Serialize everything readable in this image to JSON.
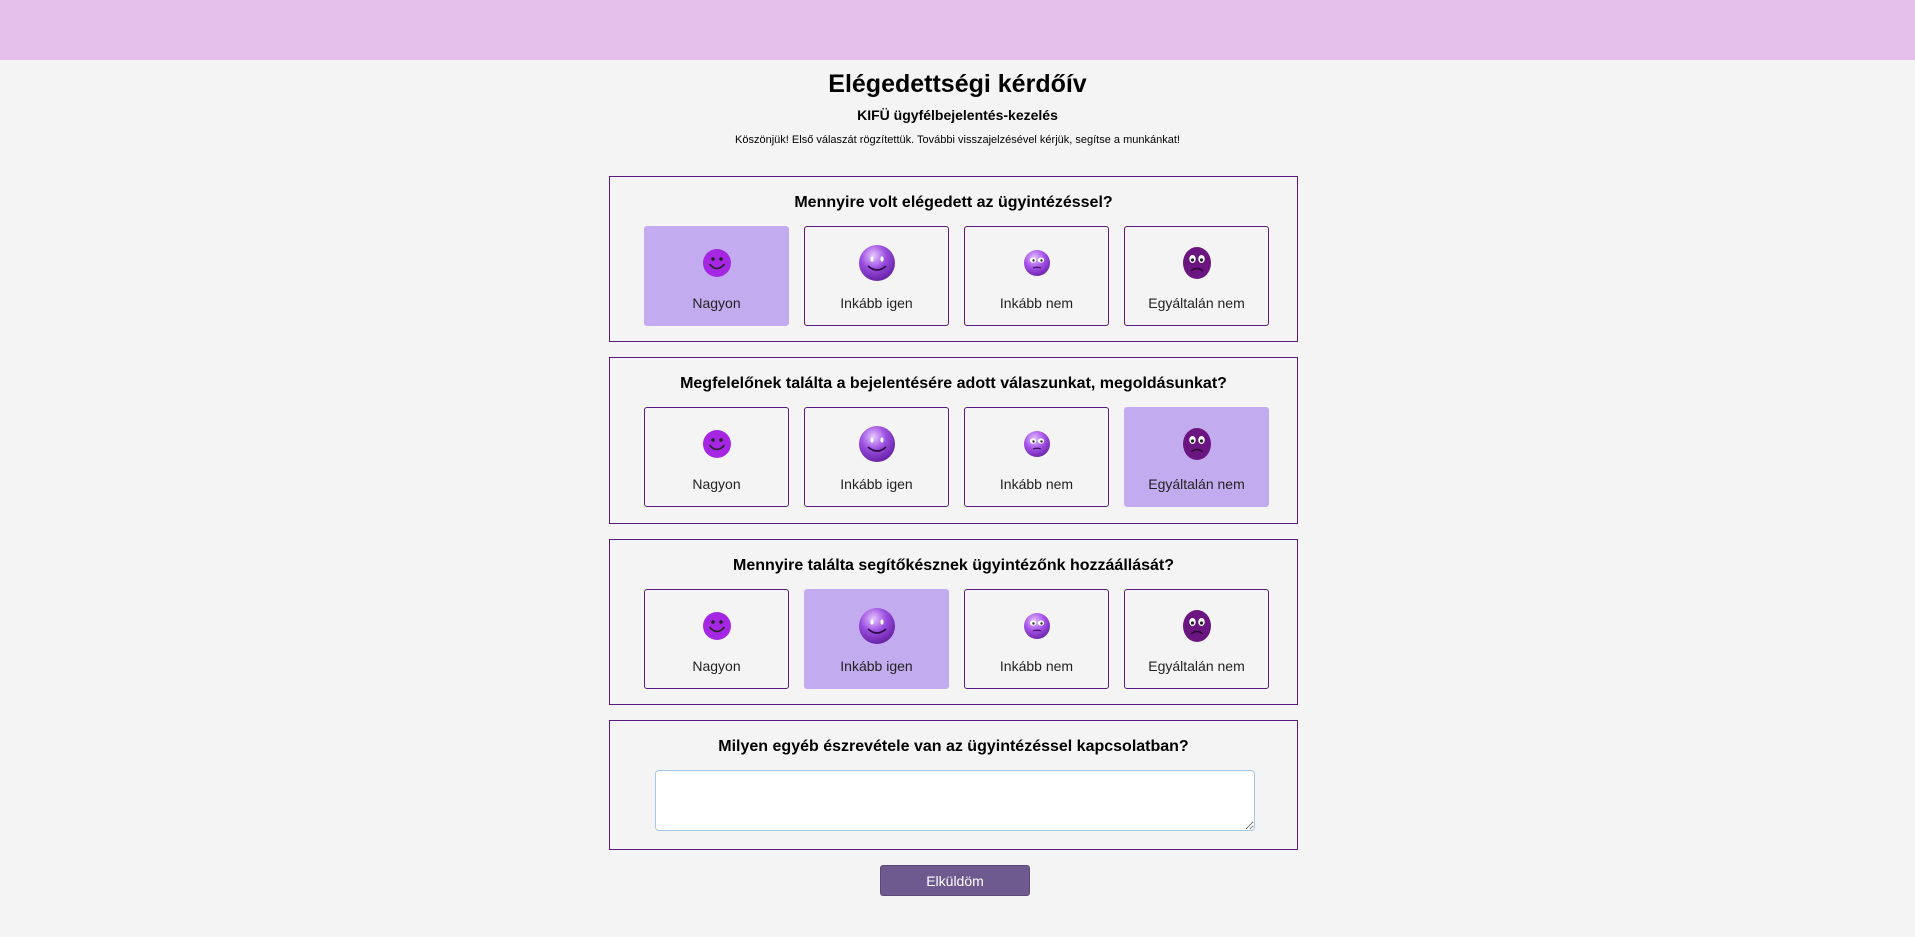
{
  "header": {
    "title": "Elégedettségi kérdőív",
    "subtitle": "KIFÜ ügyfélbejelentés-kezelés",
    "thanks": "Köszönjük! Első válaszát rögzítettük. További visszajelzésével kérjük, segítse a munkánkat!"
  },
  "questions": [
    {
      "title": "Mennyire volt elégedett az ügyintézéssel?",
      "options": [
        "Nagyon",
        "Inkább igen",
        "Inkább nem",
        "Egyáltalán nem"
      ],
      "selected": "Nagyon"
    },
    {
      "title": "Megfelelőnek találta a bejelentésére adott válaszunkat, megoldásunkat?",
      "options": [
        "Nagyon",
        "Inkább igen",
        "Inkább nem",
        "Egyáltalán nem"
      ],
      "selected": "Egyáltalán nem"
    },
    {
      "title": "Mennyire találta segítőkésznek ügyintézőnk hozzáállását?",
      "options": [
        "Nagyon",
        "Inkább igen",
        "Inkább nem",
        "Egyáltalán nem"
      ],
      "selected": "Inkább igen"
    }
  ],
  "comment": {
    "title": "Milyen egyéb észrevétele van az ügyintézéssel kapcsolatban?",
    "value": ""
  },
  "submit_label": "Elküldöm",
  "icons": [
    "smiley-very-happy-icon",
    "smiley-happy-icon",
    "smiley-unhappy-icon",
    "smiley-very-unhappy-icon"
  ],
  "colors": {
    "topbar": "#e5c0ea",
    "border": "#5b1a7e",
    "selected": "#c3abef",
    "button": "#6e5a8f"
  }
}
